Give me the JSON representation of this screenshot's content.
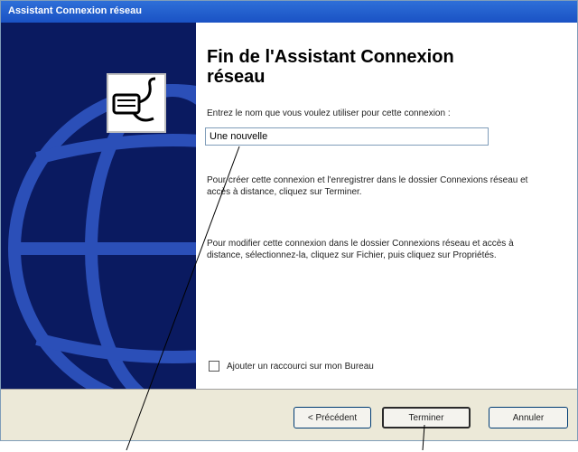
{
  "window": {
    "title": "Assistant Connexion réseau"
  },
  "side_panel": {
    "icon": "network-connection-wizard-icon",
    "background": "globe-icon"
  },
  "content": {
    "heading": "Fin de l'Assistant Connexion réseau",
    "prompt": "Entrez le nom que vous voulez utiliser pour cette connexion :",
    "name_input_value": "Une nouvelle",
    "para1": "Pour créer cette connexion et l'enregistrer dans le dossier Connexions réseau et accès à distance, cliquez sur Terminer.",
    "para2": "Pour modifier cette connexion dans le dossier Connexions réseau et accès à distance, sélectionnez-la, cliquez sur Fichier, puis cliquez sur Propriétés.",
    "shortcut_checkbox_label": "Ajouter un raccourci sur mon Bureau",
    "shortcut_checked": false
  },
  "buttons": {
    "prev_label": "< Précédent",
    "finish_label": "Terminer",
    "cancel_label": "Annuler"
  },
  "colors": {
    "titlebar": "#1a52c4",
    "side_panel": "#0a1a60",
    "globe": "#2b4fb8"
  }
}
